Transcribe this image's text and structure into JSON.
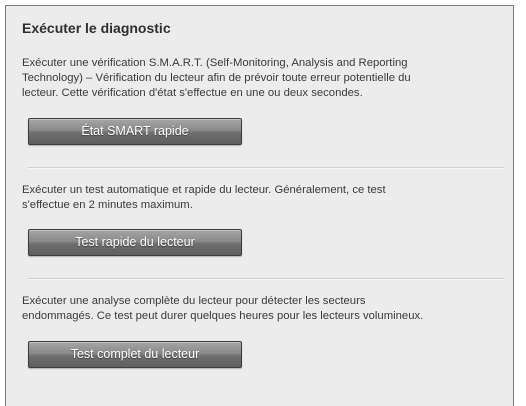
{
  "panel": {
    "title": "Exécuter le diagnostic",
    "sections": [
      {
        "description_lines": [
          "Exécuter une vérification S.M.A.R.T. (Self-Monitoring, Analysis and Reporting",
          "Technology) – Vérification du lecteur afin de prévoir toute erreur potentielle du",
          "lecteur. Cette vérification d'état s'effectue en une ou deux secondes."
        ],
        "button_label": "État SMART rapide"
      },
      {
        "description_lines": [
          "Exécuter un test automatique et rapide du lecteur. Généralement, ce test",
          "s'effectue en 2 minutes maximum."
        ],
        "button_label": "Test rapide du lecteur"
      },
      {
        "description_lines": [
          "Exécuter une analyse complète du lecteur pour détecter les secteurs",
          "endommagés. Ce test peut durer quelques heures pour les lecteurs volumineux."
        ],
        "button_label": "Test complet du lecteur"
      }
    ]
  }
}
